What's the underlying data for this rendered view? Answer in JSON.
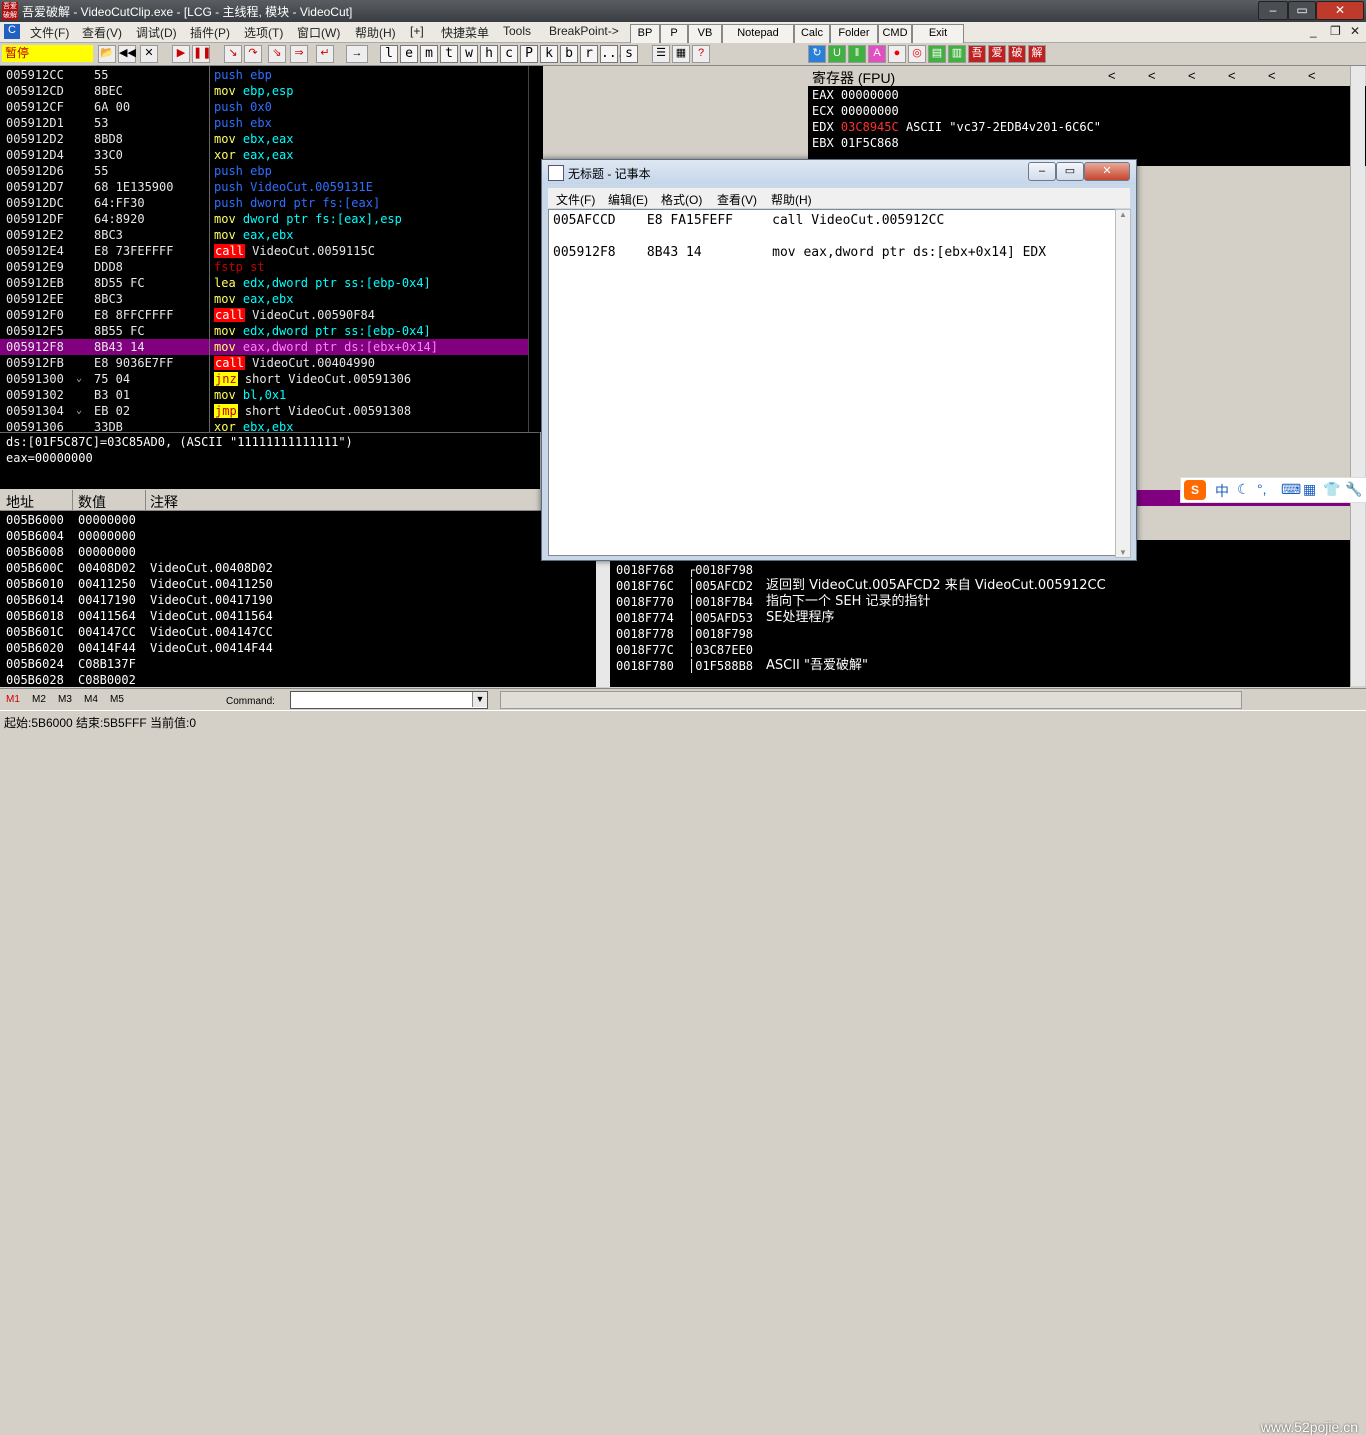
{
  "window": {
    "title": "吾爱破解 - VideoCutClip.exe - [LCG - 主线程, 模块 - VideoCut]",
    "icon_text": "吾爱破解",
    "controls": [
      "minimize-icon",
      "maximize-icon",
      "close-icon"
    ]
  },
  "menu": {
    "items": [
      "文件(F)",
      "查看(V)",
      "调试(D)",
      "插件(P)",
      "选项(T)",
      "窗口(W)",
      "帮助(H)",
      "[+]",
      "快捷菜单",
      "Tools",
      "BreakPoint->"
    ],
    "tool_buttons": [
      "BP",
      "P",
      "VB",
      "Notepad",
      "Calc",
      "Folder",
      "CMD",
      "Exit"
    ]
  },
  "toolbar": {
    "state": "暂停",
    "letters": [
      "l",
      "e",
      "m",
      "t",
      "w",
      "h",
      "c",
      "P",
      "k",
      "b",
      "r",
      "...",
      "s"
    ],
    "right_chars": [
      "吾",
      "爱",
      "破",
      "解"
    ]
  },
  "disasm": {
    "rows": [
      {
        "addr": "005912CC",
        "mark": "",
        "hex": "55",
        "mnem": "push",
        "ops": "ebp",
        "style": "push"
      },
      {
        "addr": "005912CD",
        "mark": "",
        "hex": "8BEC",
        "mnem": "mov",
        "ops": "ebp,esp",
        "style": "mov"
      },
      {
        "addr": "005912CF",
        "mark": "",
        "hex": "6A 00",
        "mnem": "push",
        "ops": "0x0",
        "style": "push"
      },
      {
        "addr": "005912D1",
        "mark": "",
        "hex": "53",
        "mnem": "push",
        "ops": "ebx",
        "style": "push"
      },
      {
        "addr": "005912D2",
        "mark": "",
        "hex": "8BD8",
        "mnem": "mov",
        "ops": "ebx,eax",
        "style": "mov"
      },
      {
        "addr": "005912D4",
        "mark": "",
        "hex": "33C0",
        "mnem": "xor",
        "ops": "eax,eax",
        "style": "mov"
      },
      {
        "addr": "005912D6",
        "mark": "",
        "hex": "55",
        "mnem": "push",
        "ops": "ebp",
        "style": "push"
      },
      {
        "addr": "005912D7",
        "mark": "",
        "hex": "68 1E135900",
        "mnem": "push",
        "ops": "VideoCut.0059131E",
        "style": "push"
      },
      {
        "addr": "005912DC",
        "mark": "",
        "hex": "64:FF30",
        "mnem": "push",
        "ops": "dword ptr fs:[eax]",
        "style": "push"
      },
      {
        "addr": "005912DF",
        "mark": "",
        "hex": "64:8920",
        "mnem": "mov",
        "ops": "dword ptr fs:[eax],esp",
        "style": "mov"
      },
      {
        "addr": "005912E2",
        "mark": "",
        "hex": "8BC3",
        "mnem": "mov",
        "ops": "eax,ebx",
        "style": "mov"
      },
      {
        "addr": "005912E4",
        "mark": "",
        "hex": "E8 73FEFFFF",
        "mnem": "call",
        "ops": "VideoCut.0059115C",
        "style": "call"
      },
      {
        "addr": "005912E9",
        "mark": "",
        "hex": "DDD8",
        "mnem": "fstp",
        "ops": "st",
        "style": "fstp"
      },
      {
        "addr": "005912EB",
        "mark": "",
        "hex": "8D55 FC",
        "mnem": "lea",
        "ops": "edx,dword ptr ss:[ebp-0x4]",
        "style": "mov"
      },
      {
        "addr": "005912EE",
        "mark": "",
        "hex": "8BC3",
        "mnem": "mov",
        "ops": "eax,ebx",
        "style": "mov"
      },
      {
        "addr": "005912F0",
        "mark": "",
        "hex": "E8 8FFCFFFF",
        "mnem": "call",
        "ops": "VideoCut.00590F84",
        "style": "call"
      },
      {
        "addr": "005912F5",
        "mark": "",
        "hex": "8B55 FC",
        "mnem": "mov",
        "ops": "edx,dword ptr ss:[ebp-0x4]",
        "style": "mov"
      },
      {
        "addr": "005912F8",
        "mark": "",
        "hex": "8B43 14",
        "mnem": "mov",
        "ops": "eax,dword ptr ds:[ebx+0x14]",
        "style": "sel"
      },
      {
        "addr": "005912FB",
        "mark": "",
        "hex": "E8 9036E7FF",
        "mnem": "call",
        "ops": "VideoCut.00404990",
        "style": "call"
      },
      {
        "addr": "00591300",
        "mark": "⌄",
        "hex": "75 04",
        "mnem": "jnz",
        "ops": "short VideoCut.00591306",
        "style": "jump"
      },
      {
        "addr": "00591302",
        "mark": "",
        "hex": "B3 01",
        "mnem": "mov",
        "ops": "bl,0x1",
        "style": "mov"
      },
      {
        "addr": "00591304",
        "mark": "⌄",
        "hex": "EB 02",
        "mnem": "jmp",
        "ops": "short VideoCut.00591308",
        "style": "jump"
      },
      {
        "addr": "00591306",
        "mark": "",
        "hex": "33DB",
        "mnem": "xor",
        "ops": "ebx,ebx",
        "style": "mov"
      }
    ]
  },
  "info": {
    "line1": "ds:[01F5C87C]=03C85AD0, (ASCII \"11111111111111\")",
    "line2": "eax=00000000"
  },
  "dump": {
    "headers": [
      "地址",
      "数值",
      "注释"
    ],
    "rows": [
      {
        "addr": "005B6000",
        "val": "00000000",
        "comment": ""
      },
      {
        "addr": "005B6004",
        "val": "00000000",
        "comment": ""
      },
      {
        "addr": "005B6008",
        "val": "00000000",
        "comment": ""
      },
      {
        "addr": "005B600C",
        "val": "00408D02",
        "comment": "VideoCut.00408D02"
      },
      {
        "addr": "005B6010",
        "val": "00411250",
        "comment": "VideoCut.00411250"
      },
      {
        "addr": "005B6014",
        "val": "00417190",
        "comment": "VideoCut.00417190"
      },
      {
        "addr": "005B6018",
        "val": "00411564",
        "comment": "VideoCut.00411564"
      },
      {
        "addr": "005B601C",
        "val": "004147CC",
        "comment": "VideoCut.004147CC"
      },
      {
        "addr": "005B6020",
        "val": "00414F44",
        "comment": "VideoCut.00414F44"
      },
      {
        "addr": "005B6024",
        "val": "C08B137F",
        "comment": ""
      },
      {
        "addr": "005B6028",
        "val": "C08B0002",
        "comment": ""
      }
    ]
  },
  "registers": {
    "title": "寄存器 (FPU)",
    "rows": [
      {
        "name": "EAX",
        "value": "00000000",
        "note": "",
        "hl": false
      },
      {
        "name": "ECX",
        "value": "00000000",
        "note": "",
        "hl": false
      },
      {
        "name": "EDX",
        "value": "03C8945C",
        "note": "ASCII \"vc37-2EDB4v201-6C6C\"",
        "hl": true
      },
      {
        "name": "EBX",
        "value": "01F5C868",
        "note": "",
        "hl": false
      }
    ]
  },
  "stack": {
    "rows": [
      {
        "addr": "0018F768",
        "val": "┌0018F798",
        "comment": ""
      },
      {
        "addr": "0018F76C",
        "val": "│005AFCD2",
        "comment": "返回到 VideoCut.005AFCD2 来自 VideoCut.005912CC"
      },
      {
        "addr": "0018F770",
        "val": "│0018F7B4",
        "comment": "指向下一个 SEH 记录的指针"
      },
      {
        "addr": "0018F774",
        "val": "│005AFD53",
        "comment": "SE处理程序"
      },
      {
        "addr": "0018F778",
        "val": "│0018F798",
        "comment": ""
      },
      {
        "addr": "0018F77C",
        "val": "│03C87EE0",
        "comment": ""
      },
      {
        "addr": "0018F780",
        "val": "│01F588B8",
        "comment": "ASCII \"吾爱破解\""
      }
    ]
  },
  "notepad": {
    "title": "无标题 - 记事本",
    "menu": [
      "文件(F)",
      "编辑(E)",
      "格式(O)",
      "查看(V)",
      "帮助(H)"
    ],
    "lines": [
      "005AFCCD    E8 FA15FEFF     call VideoCut.005912CC",
      "005912F8    8B43 14         mov eax,dword ptr ds:[ebx+0x14] EDX"
    ]
  },
  "ime": {
    "logo": "S",
    "mode": "中"
  },
  "cmdbar": {
    "tabs": [
      "M1",
      "M2",
      "M3",
      "M4",
      "M5"
    ],
    "command_label": "Command:",
    "command_value": ""
  },
  "status": {
    "text": "起始:5B6000 结束:5B5FFF 当前值:0"
  },
  "watermark": "www.52pojie.cn",
  "colors": {
    "selection": "#800080",
    "call": "#ff0000",
    "jump": "#ffff00",
    "push": "#3070ff",
    "register": "#00ffff"
  }
}
